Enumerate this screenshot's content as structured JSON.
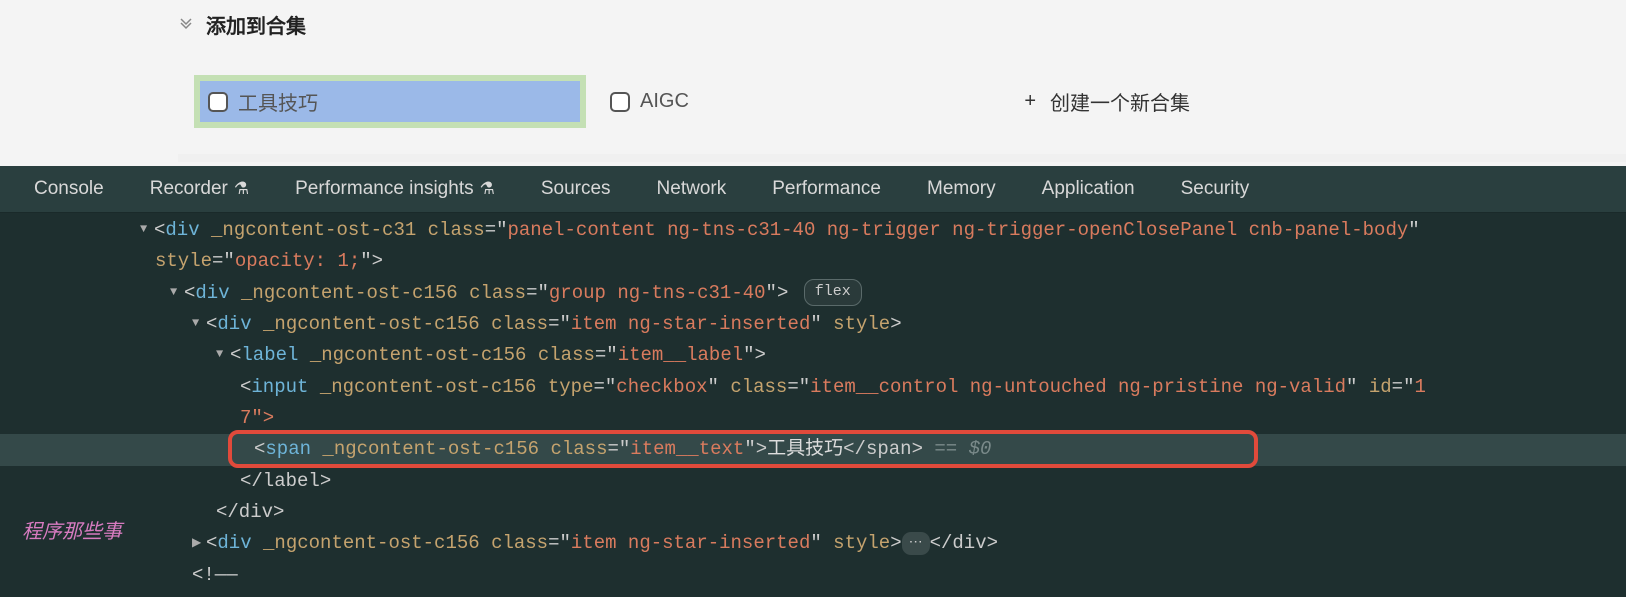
{
  "panel": {
    "header": "添加到合集",
    "items": [
      {
        "label": "工具技巧",
        "checked": false,
        "highlighted": true
      },
      {
        "label": "AIGC",
        "checked": false,
        "highlighted": false
      }
    ],
    "create_label": "创建一个新合集"
  },
  "devtools": {
    "tabs": [
      "Console",
      "Recorder",
      "Performance insights",
      "Sources",
      "Network",
      "Performance",
      "Memory",
      "Application",
      "Security"
    ],
    "flex_badge": "flex",
    "selected_ref": "== $0",
    "dom": {
      "line1": {
        "tag": "div",
        "attr_ng": "_ngcontent-ost-c31",
        "class_val": "panel-content ng-tns-c31-40 ng-trigger ng-trigger-openClosePanel cnb-panel-body",
        "style_label": "style",
        "style_val": "opacity: 1;"
      },
      "line2": {
        "tag": "div",
        "attr_ng": "_ngcontent-ost-c156",
        "class_val": "group ng-tns-c31-40"
      },
      "line3": {
        "tag": "div",
        "attr_ng": "_ngcontent-ost-c156",
        "class_val": "item ng-star-inserted",
        "style_label": "style"
      },
      "line4": {
        "tag": "label",
        "attr_ng": "_ngcontent-ost-c156",
        "class_val": "item__label"
      },
      "line5": {
        "tag": "input",
        "attr_ng": "_ngcontent-ost-c156",
        "type_val": "checkbox",
        "class_val": "item__control ng-untouched ng-pristine ng-valid",
        "id_label": "id",
        "id_frag": "1",
        "trail": "7\">"
      },
      "line6": {
        "tag": "span",
        "attr_ng": "_ngcontent-ost-c156",
        "class_val": "item__text",
        "text": "工具技巧",
        "close": "</span>"
      },
      "line7": {
        "close": "</label>"
      },
      "line8": {
        "close": "</div>"
      },
      "line9": {
        "tag": "div",
        "attr_ng": "_ngcontent-ost-c156",
        "class_val": "item ng-star-inserted",
        "style_label": "style",
        "close": "</div>"
      },
      "line10": {
        "text": "<!——"
      }
    }
  },
  "watermark": "程序那些事",
  "kw": {
    "class": "class",
    "type": "type",
    "eq": "=",
    "lt": "<",
    "gt": ">",
    "slash": "/",
    "q": "\""
  }
}
